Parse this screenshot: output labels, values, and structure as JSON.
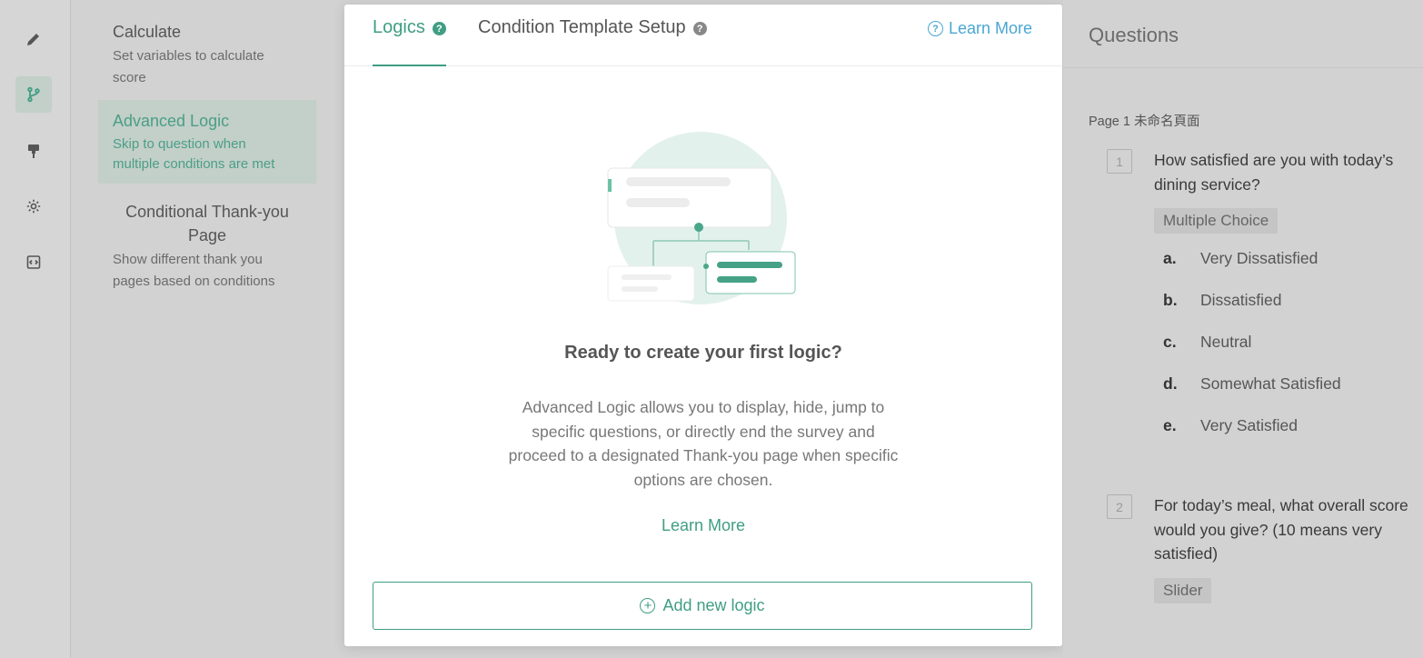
{
  "rail": {
    "items": [
      {
        "icon": "pencil-icon"
      },
      {
        "icon": "branch-icon"
      },
      {
        "icon": "paint-roller-icon"
      },
      {
        "icon": "gear-icon"
      },
      {
        "icon": "code-icon"
      }
    ]
  },
  "logic_types": [
    {
      "title": "Calculate",
      "desc_1": "Set variables to calculate",
      "desc_2": "score"
    },
    {
      "title": "Advanced Logic",
      "desc_1": "Skip to question when",
      "desc_2": "multiple conditions are met"
    },
    {
      "title_1": "Conditional Thank-you",
      "title_2": "Page",
      "desc_1": "Show different thank you",
      "desc_2": "pages based on conditions"
    }
  ],
  "modal": {
    "tabs": [
      {
        "label": "Logics",
        "help": "?"
      },
      {
        "label": "Condition Template Setup",
        "help": "?"
      }
    ],
    "learn_more_top": "Learn More",
    "learn_more_icon": "?",
    "empty_title": "Ready to create your first logic?",
    "empty_desc": [
      "Advanced Logic allows you to display, hide, jump to",
      "specific questions, or directly end the survey and",
      "proceed to a designated Thank-you page when specific",
      "options are chosen."
    ],
    "learn_more_mid": "Learn More",
    "add_button": "Add new logic",
    "add_icon": "+"
  },
  "questions": {
    "header": "Questions",
    "page_label": "Page 1 未命名頁面",
    "items": [
      {
        "number": "1",
        "text_1": "How satisfied are you with today’s",
        "text_2": "dining service?",
        "type": "Multiple Choice",
        "options": [
          {
            "letter": "a.",
            "label": "Very Dissatisfied"
          },
          {
            "letter": "b.",
            "label": "Dissatisfied"
          },
          {
            "letter": "c.",
            "label": "Neutral"
          },
          {
            "letter": "d.",
            "label": "Somewhat Satisfied"
          },
          {
            "letter": "e.",
            "label": "Very Satisfied"
          }
        ]
      },
      {
        "number": "2",
        "text_1": "For today’s meal, what overall score",
        "text_2": "would you give? (10 means very",
        "text_3": "satisfied)",
        "type": "Slider"
      }
    ]
  },
  "colors": {
    "accent": "#3f9e83",
    "link_blue": "#4aa7d4",
    "overlay_bg": "#d2d2d2"
  }
}
